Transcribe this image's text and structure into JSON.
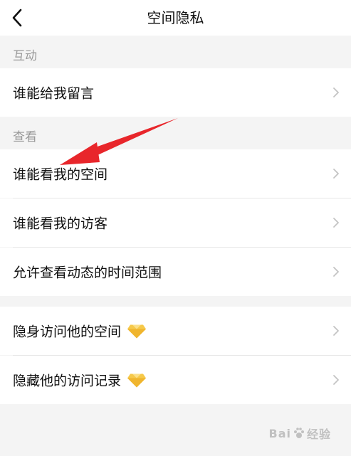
{
  "header": {
    "title": "空间隐私",
    "back_icon": "back-chevron-icon"
  },
  "sections": [
    {
      "title": "互动",
      "items": [
        {
          "label": "谁能给我留言"
        }
      ]
    },
    {
      "title": "查看",
      "items": [
        {
          "label": "谁能看我的空间"
        },
        {
          "label": "谁能看我的访客"
        },
        {
          "label": "允许查看动态的时间范围"
        }
      ]
    },
    {
      "title": "",
      "items": [
        {
          "label": "隐身访问他的空间",
          "badge_icon": "diamond-icon"
        },
        {
          "label": "隐藏他的访问记录",
          "badge_icon": "diamond-icon"
        }
      ]
    }
  ],
  "watermark": {
    "text_left": "Bai",
    "text_right": "经验"
  },
  "colors": {
    "background": "#f4f4f4",
    "section_text": "#999999",
    "diamond": "#f6c94a",
    "annotation_arrow": "#e8262b"
  }
}
